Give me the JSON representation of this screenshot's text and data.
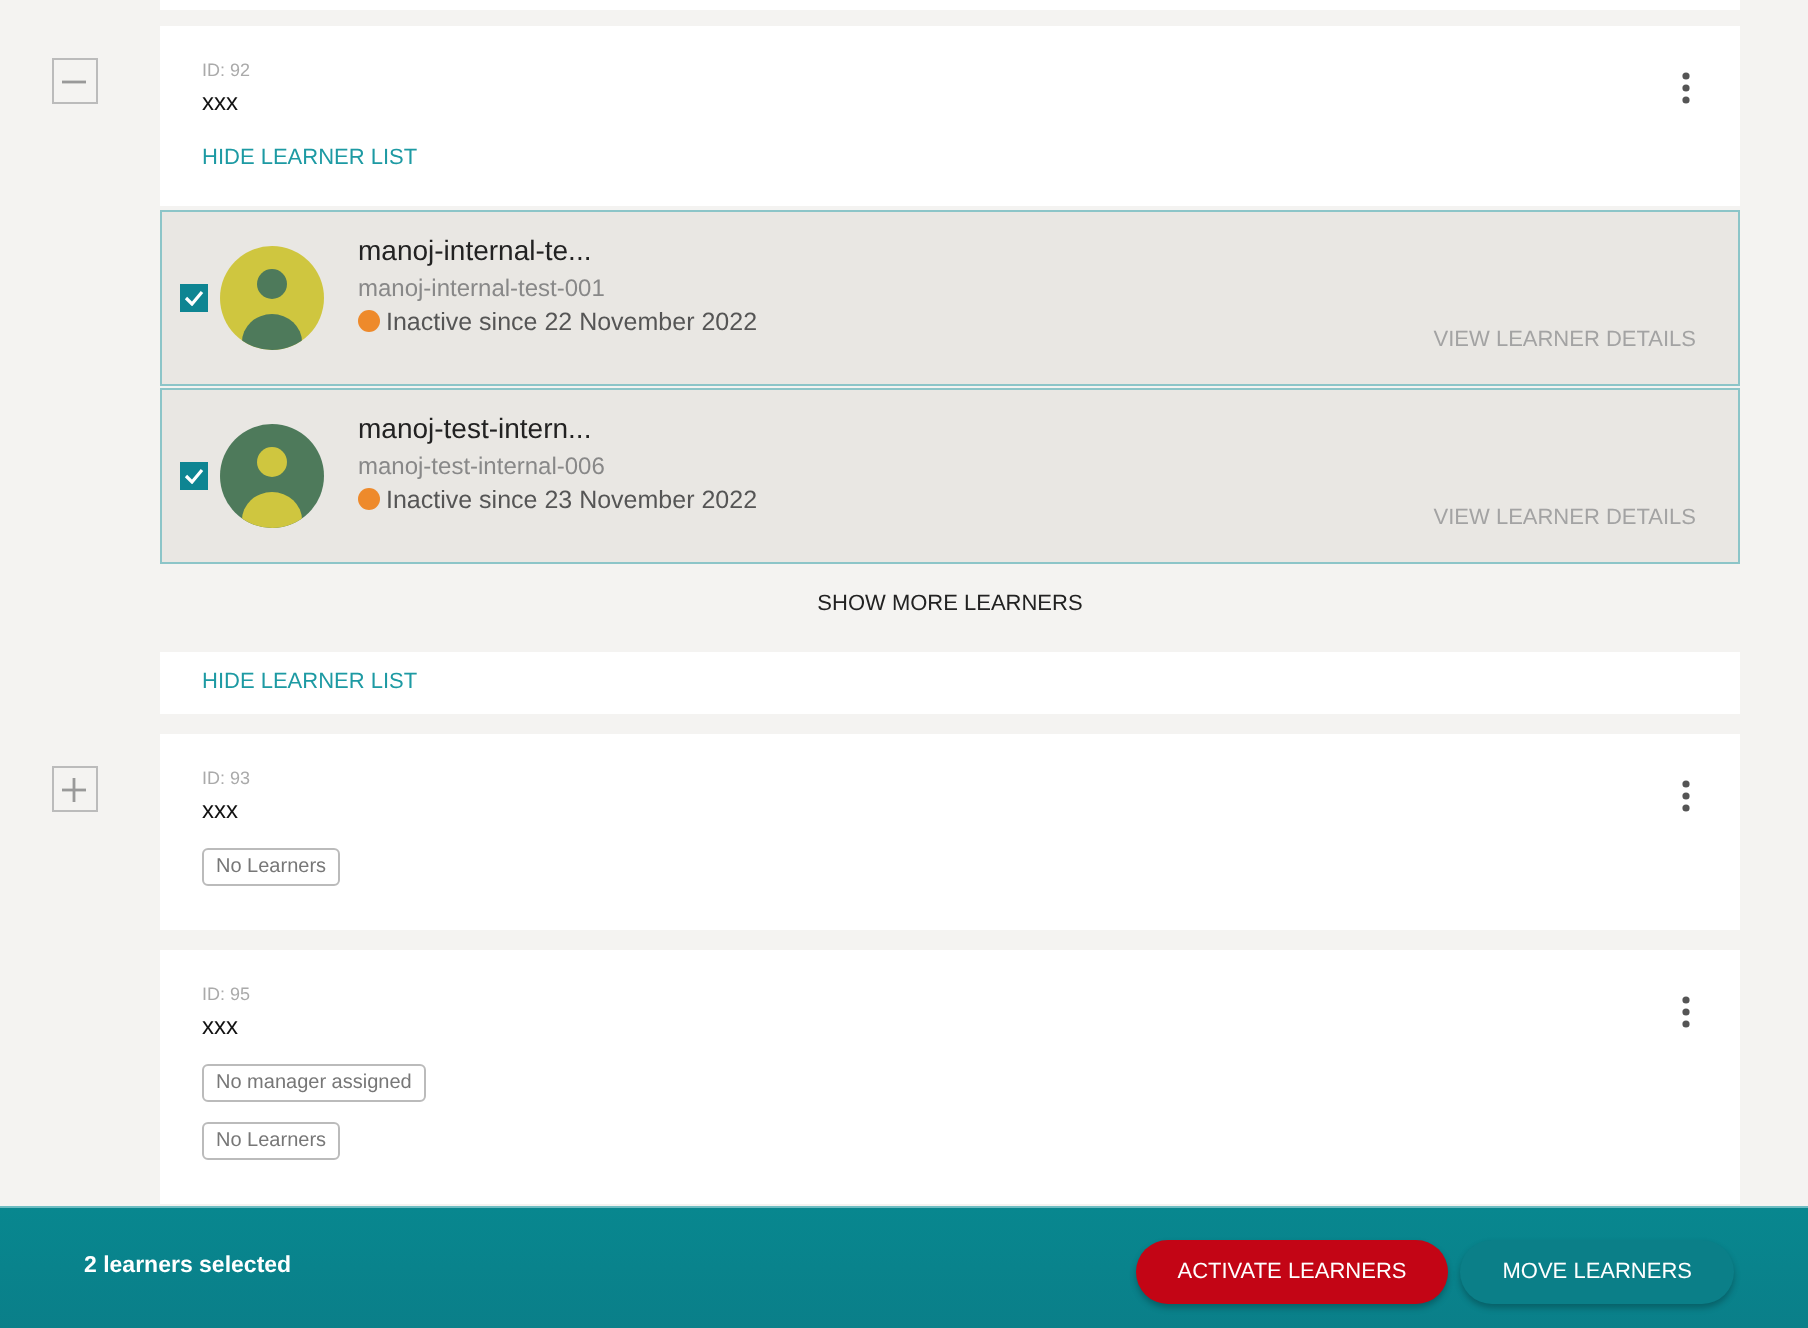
{
  "groups": [
    {
      "id_label": "ID: 92",
      "name": "xxx",
      "expanded": true,
      "hide_link": "HIDE LEARNER LIST",
      "learners": [
        {
          "name": "manoj-internal-te...",
          "username": "manoj-internal-test-001",
          "status": "Inactive since 22 November 2022",
          "checked": true,
          "kind": "light",
          "details_link": "VIEW LEARNER DETAILS"
        },
        {
          "name": "manoj-test-intern...",
          "username": "manoj-test-internal-006",
          "status": "Inactive since 23 November 2022",
          "checked": true,
          "kind": "dark",
          "details_link": "VIEW LEARNER DETAILS"
        }
      ],
      "show_more": "SHOW MORE LEARNERS",
      "footer_link": "HIDE LEARNER LIST"
    },
    {
      "id_label": "ID: 93",
      "name": "xxx",
      "expanded": false,
      "tags": [
        "No Learners"
      ]
    },
    {
      "id_label": "ID: 95",
      "name": "xxx",
      "tags": [
        "No manager assigned",
        "No Learners"
      ]
    }
  ],
  "selection_bar": {
    "count": "2 learners selected",
    "buttons": [
      {
        "label": "ACTIVATE LEARNERS",
        "kind": "primary"
      },
      {
        "label": "MOVE LEARNERS",
        "kind": "secondary"
      }
    ]
  }
}
